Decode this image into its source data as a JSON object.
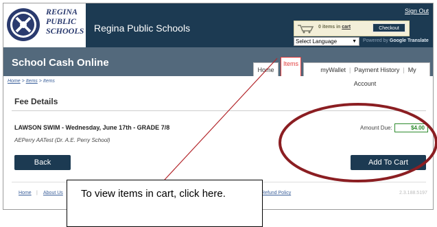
{
  "header": {
    "logo_lines": [
      "REGINA",
      "PUBLIC",
      "SCHOOLS"
    ],
    "site_title": "Regina Public Schools",
    "sign_out": "Sign Out",
    "cart": {
      "count_text": "0 items in",
      "cart_link": "cart",
      "checkout": "Checkout"
    },
    "language": {
      "selected": "Select Language",
      "powered_prefix": "Powered by",
      "google": "Google",
      "translate": "Translate"
    }
  },
  "nav": {
    "app_title": "School Cash Online",
    "tabs": {
      "home": "Home",
      "items": "Items",
      "mywallet": "myWallet",
      "payment_history": "Payment History",
      "my_account": "My Account"
    }
  },
  "breadcrumb": {
    "home": "Home",
    "sep": ">",
    "items": "Items",
    "current": "Items"
  },
  "main": {
    "title": "Fee Details",
    "item_title": "LAWSON SWIM - Wednesday, June 17th - GRADE 7/8",
    "school": "AEPerry AATest (Dr. A.E. Perry School)",
    "amount_label": "Amount Due:",
    "amount_value": "$4.00",
    "back": "Back",
    "add_to_cart": "Add To Cart"
  },
  "footer": {
    "home": "Home",
    "sep": "|",
    "about": "About Us",
    "refund": "Refund Policy",
    "version": "2.3.188.5197"
  },
  "annotation": {
    "callout_text": "To view items in cart, click here."
  },
  "colors": {
    "header_bg": "#1c3a52",
    "nav_bg": "#53697c",
    "annotation_red": "#b3262b",
    "amount_green": "#2c8a2c"
  }
}
